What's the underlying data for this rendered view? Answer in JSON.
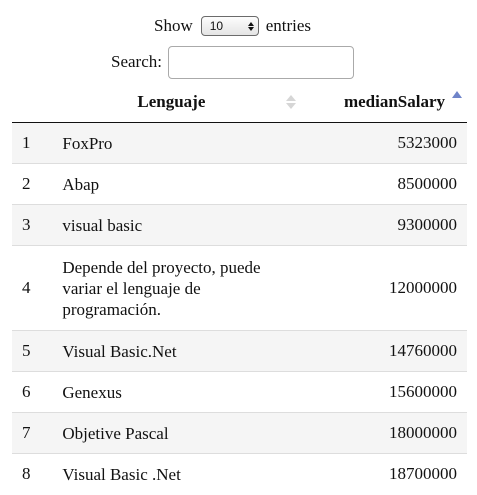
{
  "length_control": {
    "prefix": "Show",
    "selected": "10",
    "suffix": "entries"
  },
  "search": {
    "label": "Search:",
    "value": ""
  },
  "table": {
    "columns": [
      "",
      "Lenguaje",
      "medianSalary"
    ],
    "sorted_column": "medianSalary",
    "sort_direction": "ascending",
    "rows": [
      {
        "idx": "1",
        "lenguaje": "FoxPro",
        "salary": "5323000",
        "height": 41
      },
      {
        "idx": "2",
        "lenguaje": "Abap",
        "salary": "8500000",
        "height": 41
      },
      {
        "idx": "3",
        "lenguaje": "visual basic",
        "salary": "9300000",
        "height": 41
      },
      {
        "idx": "4",
        "lenguaje": "Depende del proyecto, puede variar el lenguaje de programación.",
        "salary": "12000000",
        "height": 85
      },
      {
        "idx": "5",
        "lenguaje": "Visual Basic.Net",
        "salary": "14760000",
        "height": 41
      },
      {
        "idx": "6",
        "lenguaje": "Genexus",
        "salary": "15600000",
        "height": 41
      },
      {
        "idx": "7",
        "lenguaje": "Objetive Pascal",
        "salary": "18000000",
        "height": 41
      },
      {
        "idx": "8",
        "lenguaje": "Visual Basic .Net",
        "salary": "18700000",
        "height": 41
      }
    ]
  }
}
